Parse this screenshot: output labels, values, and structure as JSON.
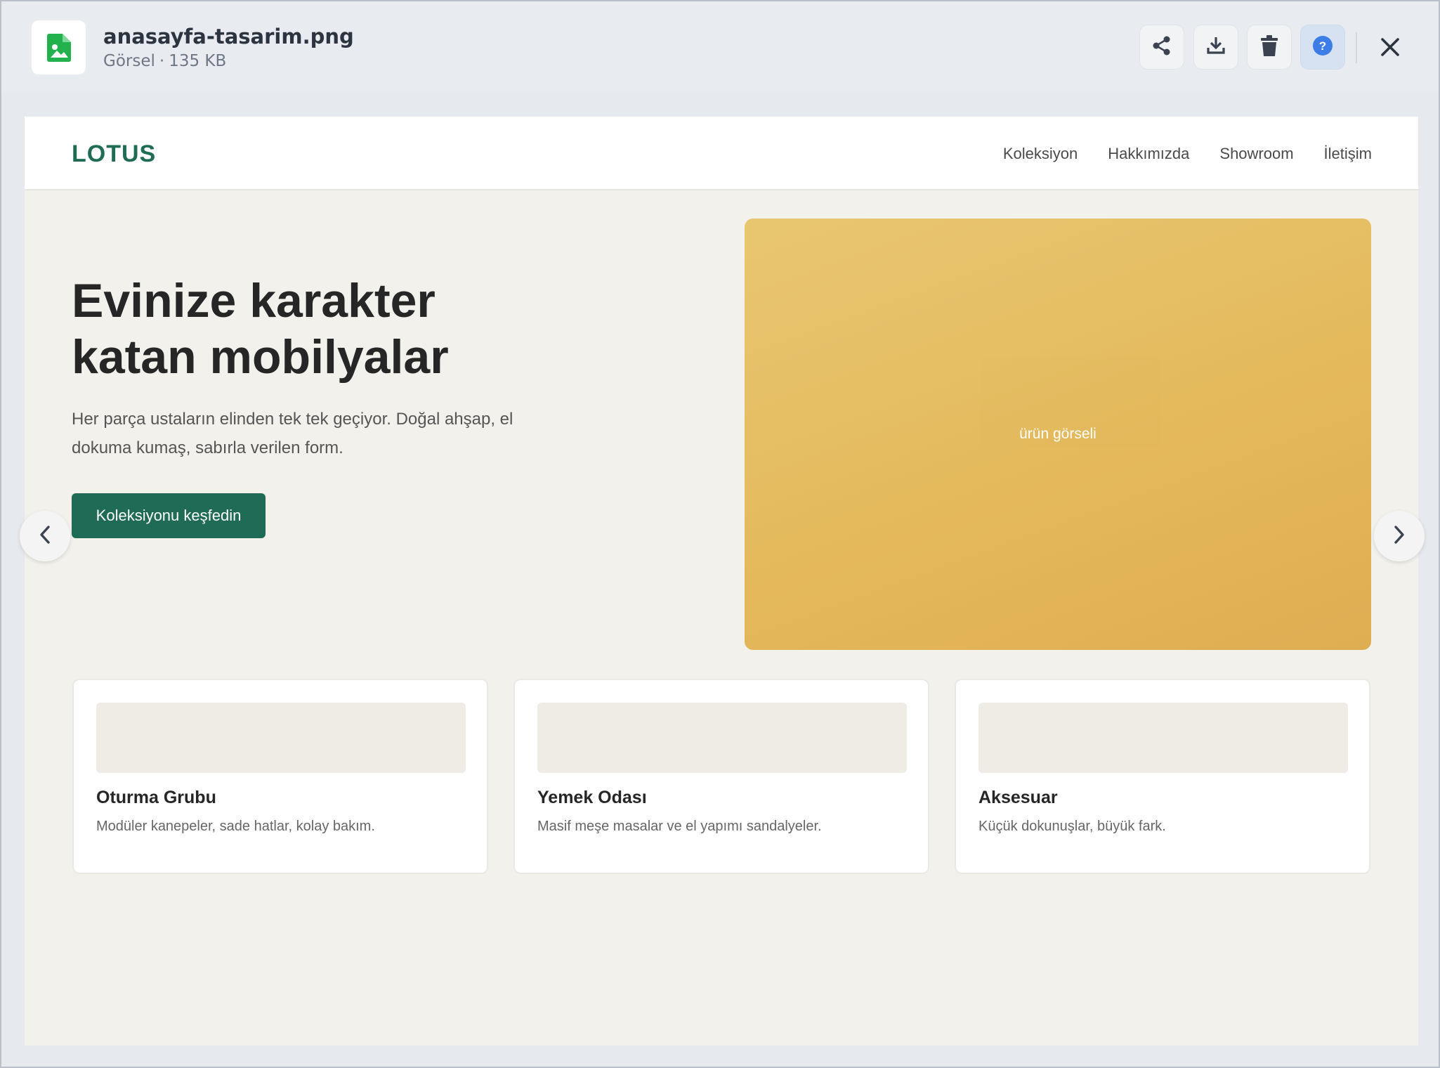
{
  "viewer": {
    "file_name": "anasayfa-tasarim.png",
    "file_type": "Görsel",
    "file_meta_sep": "·",
    "file_size": "135 KB",
    "toolbar": {
      "share_icon": "share-icon",
      "download_icon": "download-icon",
      "delete_icon": "trash-icon",
      "help_icon": "help-icon",
      "help_glyph": "?",
      "close_icon": "close-icon"
    },
    "colors": {
      "file_icon": "#22b14c",
      "help_accent": "#3d7de8"
    }
  },
  "page": {
    "logo": "LOTUS",
    "nav": [
      "Koleksiyon",
      "Hakkımızda",
      "Showroom",
      "İletişim"
    ],
    "hero": {
      "title_line1": "Evinize karakter",
      "title_line2": "katan mobilyalar",
      "subtitle": "Her parça ustaların elinden tek tek geçiyor. Doğal ahşap, el dokuma kumaş, sabırla verilen form.",
      "cta": "Koleksiyonu keşfedin",
      "image_label": "ürün görseli"
    },
    "cards": [
      {
        "title": "Oturma Grubu",
        "desc": "Modüler kanepeler, sade hatlar, kolay bakım."
      },
      {
        "title": "Yemek Odası",
        "desc": "Masif meşe masalar ve el yapımı sandalyeler."
      },
      {
        "title": "Aksesuar",
        "desc": "Küçük dokunuşlar, büyük fark."
      }
    ],
    "colors": {
      "brand": "#1f6b56",
      "hero_image": "#e3b654",
      "background": "#f3f1ec"
    }
  }
}
